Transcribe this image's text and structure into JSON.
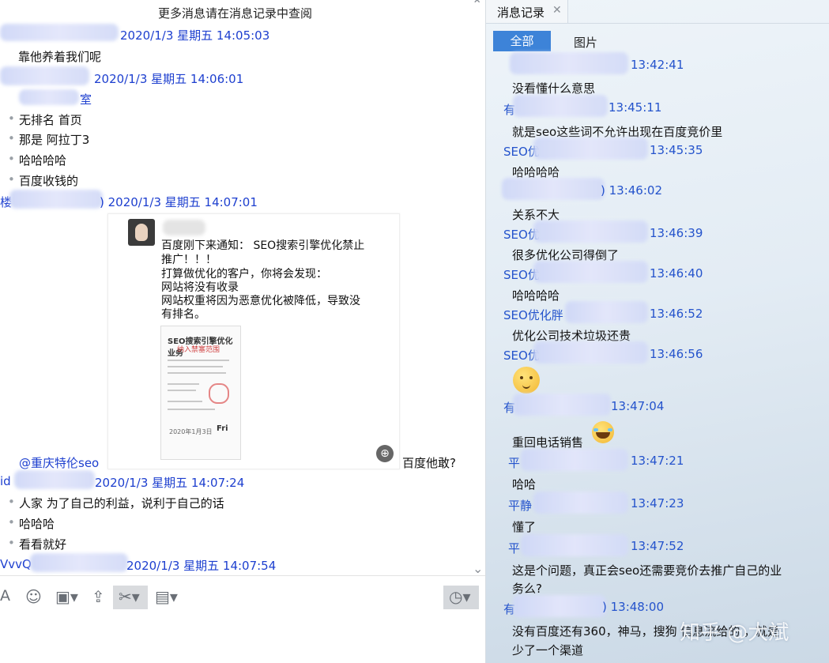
{
  "chat": {
    "notice": "更多消息请在消息记录中查阅",
    "messages": [
      {
        "meta": "2020/1/3 星期五 14:05:03",
        "lines": [
          "靠他养着我们呢"
        ]
      },
      {
        "meta": "2020/1/3 星期五 14:06:01",
        "fragment": "室",
        "lines": [
          "无排名 首页",
          "那是 阿拉丁3",
          "哈哈哈哈",
          "百度收钱的"
        ]
      },
      {
        "meta_prefix": "楼",
        "meta": ") 2020/1/3 星期五 14:07:01"
      },
      {
        "meta_prefix": "id",
        "meta": "2020/1/3 星期五 14:07:24",
        "lines": [
          "人家 为了自己的利益，说利于自己的话",
          "哈哈哈",
          "看看就好"
        ]
      },
      {
        "meta_prefix": "VvvQ",
        "meta": "2020/1/3 星期五 14:07:54"
      }
    ],
    "image_card": {
      "text_lines": [
        "百度刚下来通知： SEO搜索引擎优化禁止",
        "推广！！！",
        "打算做优化的客户，你将会发现：",
        "网站将没有收录",
        "网站权重将因为恶意优化被降低，导致没",
        "有排名。"
      ],
      "poster_title": "SEO搜索引擎优化业务",
      "poster_sub": "纳入禁塞范围",
      "poster_date": "2020年1月3日",
      "poster_day": "Fri"
    },
    "mention": "@重庆特伦seo",
    "after_image": "百度他敢?"
  },
  "history": {
    "tab_label": "消息记录",
    "filters": {
      "all": "全部",
      "images": "图片"
    },
    "entries": [
      {
        "time": "13:42:41",
        "text": "没看懂什么意思"
      },
      {
        "prefix": "有",
        "time": "13:45:11",
        "text": "就是seo这些词不允许出现在百度竞价里"
      },
      {
        "prefix": "SEO优",
        "time": "13:45:35",
        "text": "哈哈哈哈"
      },
      {
        "time": ") 13:46:02",
        "text": "关系不大"
      },
      {
        "prefix": "SEO优",
        "time": "13:46:39",
        "text": "很多优化公司得倒了"
      },
      {
        "prefix": "SEO优",
        "time": "13:46:40",
        "text": "哈哈哈哈"
      },
      {
        "prefix": "SEO优化胖",
        "time": "13:46:52",
        "text": "优化公司技术垃圾还贵"
      },
      {
        "prefix": "SEO优",
        "time": "13:46:56",
        "text": ""
      },
      {
        "prefix": "有",
        "time": "13:47:04",
        "text": "重回电话销售"
      },
      {
        "prefix": "平",
        "time": "13:47:21",
        "text": "哈哈"
      },
      {
        "prefix": "平静",
        "time": "13:47:23",
        "text": "懂了"
      },
      {
        "prefix": "平",
        "time": "13:47:52",
        "text": "这是个问题，真正会seo还需要竞价去推广自己的业"
      },
      {
        "prefix": "有",
        "time": ") 13:48:00",
        "text": "没有百度还有360，神马，搜狗 信息流给的 ，就是"
      }
    ],
    "continuations": [
      "务么?",
      "少了一个渠道"
    ]
  },
  "watermark": "知乎 @大斌"
}
